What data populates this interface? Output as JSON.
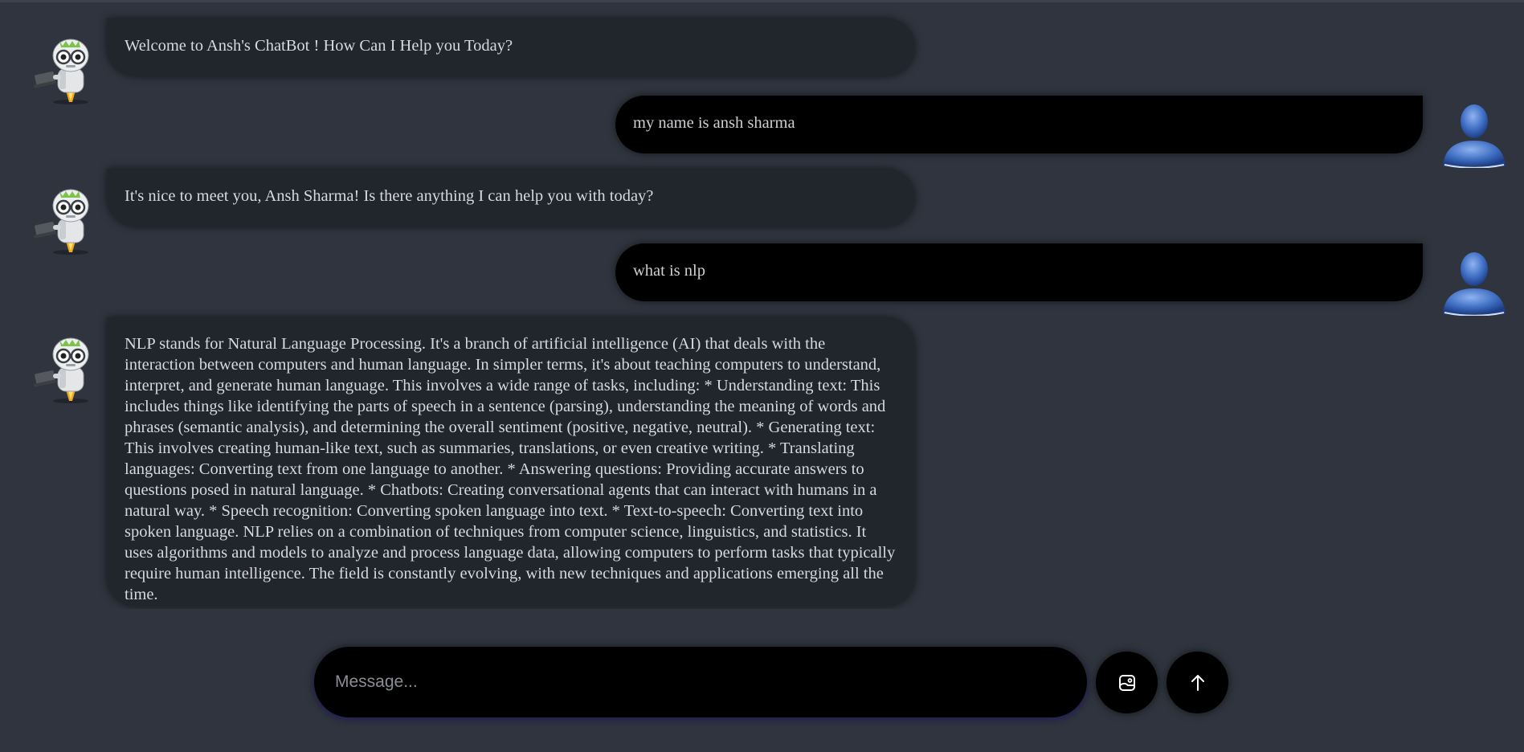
{
  "messages": [
    {
      "role": "bot",
      "text": "Welcome to Ansh's ChatBot ! How Can I Help you Today?"
    },
    {
      "role": "user",
      "text": "my name is ansh sharma"
    },
    {
      "role": "bot",
      "text": "It's nice to meet you, Ansh Sharma! Is there anything I can help you with today?"
    },
    {
      "role": "user",
      "text": "what is nlp"
    },
    {
      "role": "bot",
      "text": "NLP stands for Natural Language Processing. It's a branch of artificial intelligence (AI) that deals with the interaction between computers and human language. In simpler terms, it's about teaching computers to understand, interpret, and generate human language. This involves a wide range of tasks, including: * Understanding text: This includes things like identifying the parts of speech in a sentence (parsing), understanding the meaning of words and phrases (semantic analysis), and determining the overall sentiment (positive, negative, neutral). * Generating text: This involves creating human-like text, such as summaries, translations, or even creative writing. * Translating languages: Converting text from one language to another. * Answering questions: Providing accurate answers to questions posed in natural language. * Chatbots: Creating conversational agents that can interact with humans in a natural way. * Speech recognition: Converting spoken language into text. * Text-to-speech: Converting text into spoken language. NLP relies on a combination of techniques from computer science, linguistics, and statistics. It uses algorithms and models to analyze and process language data, allowing computers to perform tasks that typically require human intelligence. The field is constantly evolving, with new techniques and applications emerging all the time."
    }
  ],
  "composer": {
    "placeholder": "Message...",
    "value": ""
  },
  "icons": {
    "bot_avatar": "robot-avatar-icon",
    "user_avatar": "user-avatar-icon",
    "image_upload": "image-upload-icon",
    "send": "arrow-up-icon"
  },
  "colors": {
    "background": "#2f343e",
    "bot_bubble": "#21252c",
    "user_bubble": "#000000",
    "text": "#d8d9dc"
  }
}
